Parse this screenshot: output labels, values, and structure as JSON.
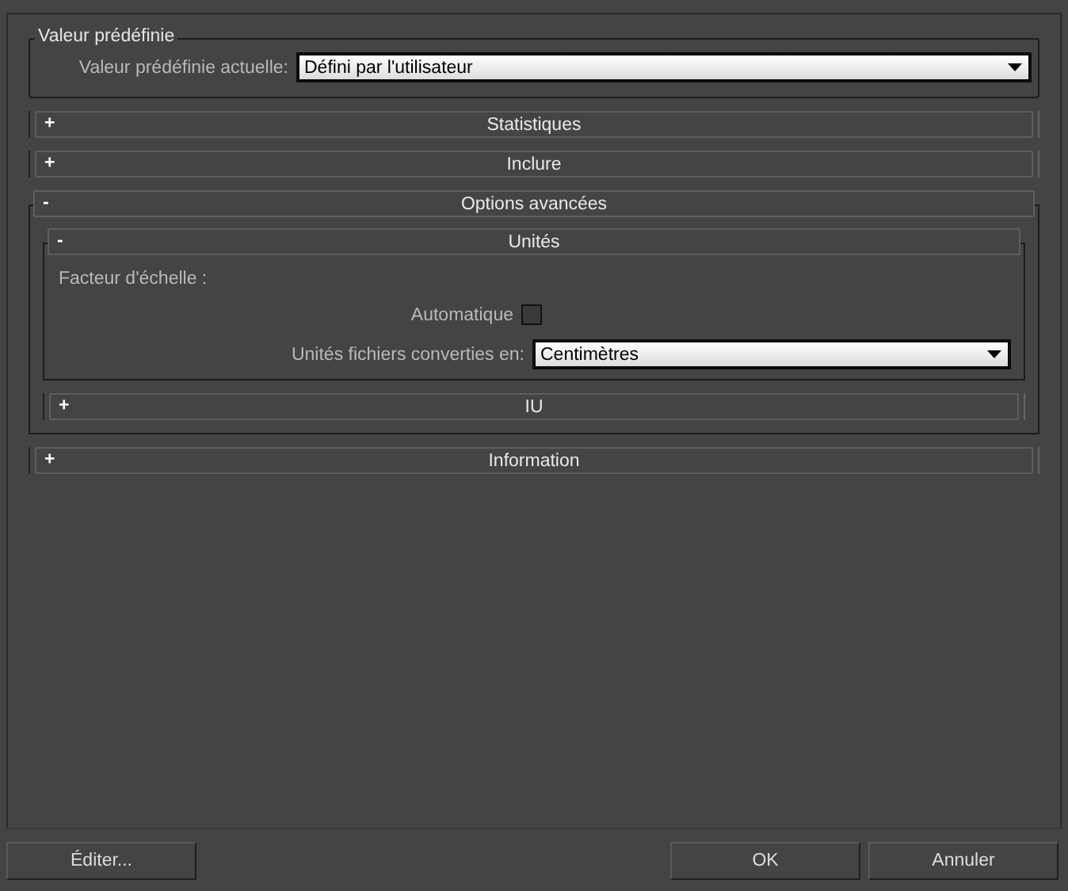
{
  "preset_group": {
    "title": "Valeur prédéfinie",
    "label": "Valeur prédéfinie actuelle:",
    "value": "Défini par l'utilisateur"
  },
  "rollouts": [
    {
      "title": "Statistiques",
      "toggle": "+",
      "expanded": false
    },
    {
      "title": "Inclure",
      "toggle": "+",
      "expanded": false
    },
    {
      "title": "Options avancées",
      "toggle": "-",
      "expanded": true,
      "children": [
        {
          "title": "Unités",
          "toggle": "-",
          "expanded": true,
          "controls": [
            {
              "kind": "label",
              "text": "Facteur d'échelle :"
            },
            {
              "kind": "checkbox",
              "label": "Automatique",
              "checked": false
            },
            {
              "kind": "dropdown",
              "label": "Unités fichiers converties en:",
              "value": "Centimètres"
            }
          ]
        },
        {
          "title": "IU",
          "toggle": "+",
          "expanded": false
        }
      ]
    },
    {
      "title": "Information",
      "toggle": "+",
      "expanded": false
    }
  ],
  "footer": {
    "left_buttons": [
      "Éditer..."
    ],
    "right_buttons": [
      "OK",
      "Annuler"
    ]
  }
}
